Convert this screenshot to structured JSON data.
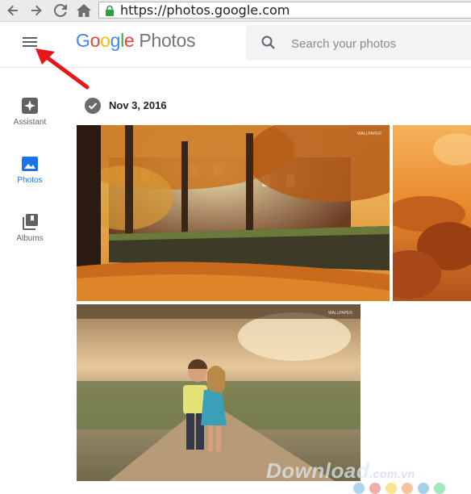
{
  "browser": {
    "url": "https://photos.google.com",
    "nav_icons": [
      "back-arrow-icon",
      "forward-arrow-icon",
      "reload-icon",
      "home-icon",
      "lock-icon"
    ]
  },
  "header": {
    "logo_google": "Google",
    "logo_photos": "Photos",
    "search_placeholder": "Search your photos"
  },
  "sidebar": {
    "items": [
      {
        "label": "Assistant",
        "icon": "assistant-icon",
        "active": false
      },
      {
        "label": "Photos",
        "icon": "photo-icon",
        "active": true
      },
      {
        "label": "Albums",
        "icon": "albums-icon",
        "active": false
      }
    ]
  },
  "content": {
    "date": "Nov 3, 2016",
    "photos": [
      {
        "subject": "autumn-park-wall",
        "watermark": "WALLPAPER"
      },
      {
        "subject": "autumn-leaves-closeup"
      },
      {
        "subject": "children-on-road",
        "watermark": "WALLPAPER"
      }
    ]
  },
  "overlay": {
    "watermark_main": "Download",
    "watermark_ext": ".com.vn"
  },
  "colors": {
    "google_blue": "#4285F4",
    "google_red": "#EA4335",
    "google_yellow": "#FBBC05",
    "google_green": "#34A853",
    "active_blue": "#1a73e8",
    "annotation_red": "#e8151b"
  }
}
